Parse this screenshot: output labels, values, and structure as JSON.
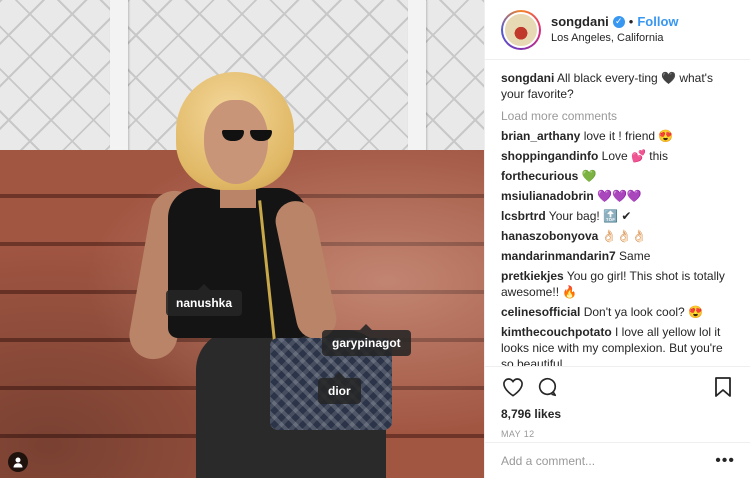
{
  "post": {
    "photo_tags": [
      "nanushka",
      "garypinagot",
      "dior"
    ]
  },
  "header": {
    "username": "songdani",
    "follow_label": "Follow",
    "dot": "•",
    "location": "Los Angeles, California"
  },
  "caption": {
    "username": "songdani",
    "text": " All black every-ting 🖤 what's your favorite?"
  },
  "load_more": "Load more comments",
  "comments": [
    {
      "user": "brian_arthany",
      "text": " love it ! friend 😍"
    },
    {
      "user": "shoppingandinfo",
      "text": " Love 💕  this"
    },
    {
      "user": "forthecurious",
      "text": " 💚"
    },
    {
      "user": "msiulianadobrin",
      "text": " 💜💜💜"
    },
    {
      "user": "lcsbrtrd",
      "text": " Your bag! 🔝 ✔"
    },
    {
      "user": "hanaszobonyova",
      "text": " 👌🏻👌🏻👌🏻"
    },
    {
      "user": "mandarinmandarin7",
      "text": " Same"
    },
    {
      "user": "pretkiekjes",
      "text": " You go girl! This shot is totally awesome!! 🔥"
    },
    {
      "user": "celinesofficial",
      "text": " Don't ya look cool? 😍"
    },
    {
      "user": "kimthecouchpotato",
      "text": " I love all yellow lol it looks nice with my complexion. But you're so beautiful"
    }
  ],
  "likes": "8,796 likes",
  "date": "MAY 12",
  "add_comment": {
    "placeholder": "Add a comment..."
  },
  "more_label": "•••",
  "icons": {
    "like": "heart-icon",
    "comment": "speech-bubble-icon",
    "save": "bookmark-icon",
    "user_tags": "person-icon",
    "verified": "verified-badge-icon"
  },
  "colors": {
    "accent": "#3897f0",
    "text": "#262626",
    "muted": "#999999"
  }
}
